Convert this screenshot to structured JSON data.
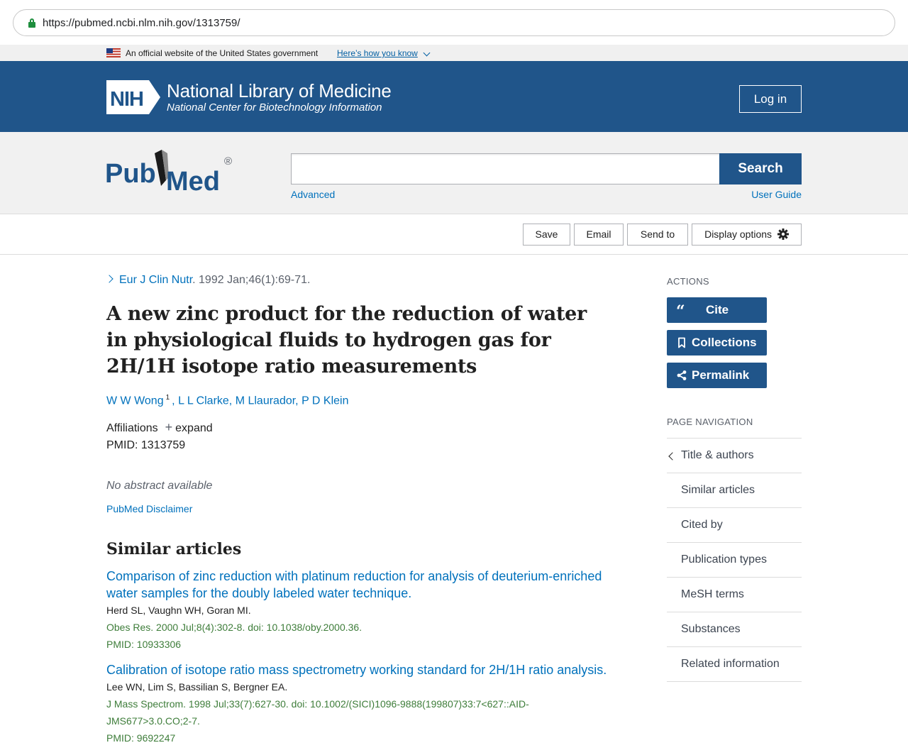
{
  "browser": {
    "url": "https://pubmed.ncbi.nlm.nih.gov/1313759/"
  },
  "gov_banner": {
    "text": "An official website of the United States government",
    "link": "Here’s how you know"
  },
  "nih_header": {
    "logo_text": "NIH",
    "title": "National Library of Medicine",
    "subtitle": "National Center for Biotechnology Information",
    "login": "Log in"
  },
  "search": {
    "logo_pub": "Pub",
    "logo_med": "Med",
    "logo_reg": "®",
    "placeholder": "",
    "value": "",
    "button": "Search",
    "advanced": "Advanced",
    "user_guide": "User Guide"
  },
  "toolbar": {
    "save": "Save",
    "email": "Email",
    "send_to": "Send to",
    "display_options": "Display options"
  },
  "article": {
    "journal": "Eur J Clin Nutr",
    "citation": ". 1992 Jan;46(1):69-71.",
    "title": "A new zinc product for the reduction of water in physiological fluids to hydrogen gas for 2H/1H isotope ratio measurements",
    "author1": "W W Wong",
    "author1_sup": "1",
    "authors_rest": "L L Clarke, M Llaurador, P D Klein",
    "affiliations": "Affiliations",
    "expand": "expand",
    "pmid": "PMID: 1313759",
    "no_abstract": "No abstract available",
    "disclaimer": "PubMed Disclaimer"
  },
  "similar": {
    "heading": "Similar articles",
    "items": [
      {
        "title": "Comparison of zinc reduction with platinum reduction for analysis of deuterium-enriched water samples for the doubly labeled water technique.",
        "authors": "Herd SL, Vaughn WH, Goran MI.",
        "citation": "Obes Res. 2000 Jul;8(4):302-8. doi: 10.1038/oby.2000.36.",
        "pmid": "PMID: 10933306"
      },
      {
        "title": "Calibration of isotope ratio mass spectrometry working standard for 2H/1H ratio analysis.",
        "authors": "Lee WN, Lim S, Bassilian S, Bergner EA.",
        "citation": "J Mass Spectrom. 1998 Jul;33(7):627-30. doi: 10.1002/(SICI)1096-9888(199807)33:7<627::AID-JMS677>3.0.CO;2-7.",
        "pmid": "PMID: 9692247"
      }
    ]
  },
  "sidebar": {
    "actions_heading": "ACTIONS",
    "cite": "Cite",
    "collections": "Collections",
    "permalink": "Permalink",
    "nav_heading": "PAGE NAVIGATION",
    "nav": [
      "Title & authors",
      "Similar articles",
      "Cited by",
      "Publication types",
      "MeSH terms",
      "Substances",
      "Related information"
    ]
  },
  "colors": {
    "nih_blue": "#20558a",
    "link_blue": "#0071bc",
    "cite_green": "#3e7d3a"
  }
}
